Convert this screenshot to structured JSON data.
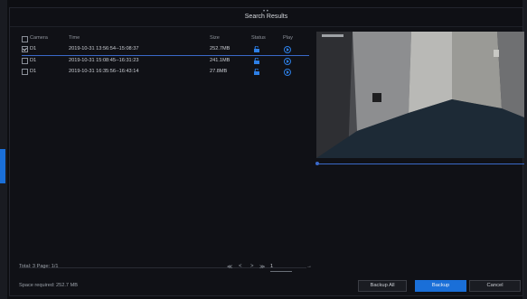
{
  "dialog": {
    "title": "Search Results",
    "header_dots": "• •"
  },
  "table": {
    "headers": {
      "camera": "Camera",
      "time": "Time",
      "size": "Size",
      "status": "Status",
      "play": "Play"
    },
    "rows": [
      {
        "camera": "D1",
        "time": "2019-10-31 13:56:54--15:08:37",
        "size": "252.7MB",
        "checked": true,
        "status_icon": "unlock-icon",
        "play_icon": "play-icon"
      },
      {
        "camera": "D1",
        "time": "2019-10-31 15:08:45--16:31:23",
        "size": "241.1MB",
        "checked": false,
        "status_icon": "unlock-icon",
        "play_icon": "play-icon"
      },
      {
        "camera": "D1",
        "time": "2019-10-31 16:35:56--16:43:14",
        "size": "27.8MB",
        "checked": false,
        "status_icon": "unlock-icon",
        "play_icon": "play-icon"
      }
    ]
  },
  "footer": {
    "total": "Total: 3  Page: 1/1",
    "space_required": "Space required: 252.7 MB",
    "pager": {
      "first": "≪",
      "prev": "<",
      "next": ">",
      "last": "≫",
      "page_value": "1",
      "go": "→"
    }
  },
  "buttons": {
    "backup_all": "Backup All",
    "backup": "Backup",
    "cancel": "Cancel"
  },
  "colors": {
    "accent": "#1a6fd8",
    "background": "#0d0e12"
  }
}
